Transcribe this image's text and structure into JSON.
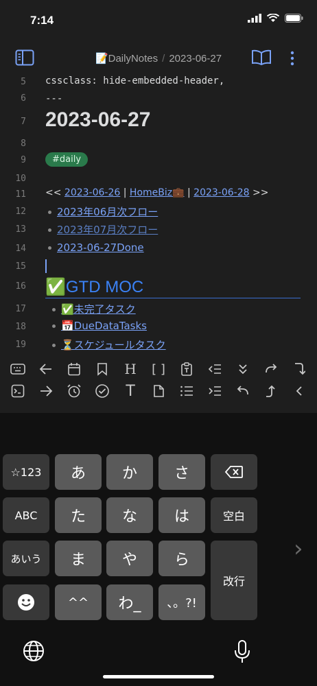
{
  "status_bar": {
    "time": "7:14"
  },
  "header": {
    "folder": "DailyNotes",
    "separator": "/",
    "note": "2023-06-27"
  },
  "editor": {
    "lines": [
      {
        "n": "5",
        "text": "cssclass: hide-embedded-header,"
      },
      {
        "n": "6",
        "text": "---"
      },
      {
        "n": "7",
        "text": "2023-06-27"
      },
      {
        "n": "8",
        "text": ""
      },
      {
        "n": "9",
        "text": "#daily"
      },
      {
        "n": "10",
        "text": ""
      },
      {
        "n": "11",
        "nav": {
          "prefix": "<<",
          "prev": "2023-06-26",
          "bar1": "|",
          "home": "HomeBiz💼",
          "bar2": "|",
          "next": "2023-06-28",
          "suffix": ">>"
        }
      },
      {
        "n": "12",
        "text": "2023年06月次フロー"
      },
      {
        "n": "13",
        "text": "2023年07月次フロー"
      },
      {
        "n": "14",
        "text": "2023-06-27Done"
      },
      {
        "n": "15",
        "text": ""
      },
      {
        "n": "16",
        "text": "✅GTD MOC"
      },
      {
        "n": "17",
        "text": "✅未完了タスク"
      },
      {
        "n": "18",
        "text": "📅DueDataTasks"
      },
      {
        "n": "19",
        "text": "⏳スケジュールタスク"
      }
    ]
  },
  "toolbar": {
    "row1": [
      "keyboard-icon",
      "arrow-left-icon",
      "calendar-icon",
      "bookmark-icon",
      "H",
      "[]",
      "clipboard-icon",
      "outdent-icon",
      "chevrons-down-icon",
      "redo-icon",
      "corner-down-right-icon"
    ],
    "row2": [
      "terminal-icon",
      "arrow-right-icon",
      "alarm-icon",
      "check-circle-icon",
      "T",
      "file-icon",
      "list-icon",
      "indent-icon",
      "undo-icon",
      "corner-up-right-icon",
      "chevron-left-icon"
    ],
    "labels": {
      "heading": "H",
      "brackets": "[ ]",
      "text": "T"
    }
  },
  "keyboard": {
    "row1": [
      "☆123",
      "あ",
      "か",
      "さ"
    ],
    "row2": [
      "ABC",
      "た",
      "な",
      "は",
      "空白"
    ],
    "row3": [
      "あいう",
      "ま",
      "や",
      "ら",
      "改行"
    ],
    "row4": [
      "^^",
      "わ_",
      "、。?!"
    ]
  }
}
